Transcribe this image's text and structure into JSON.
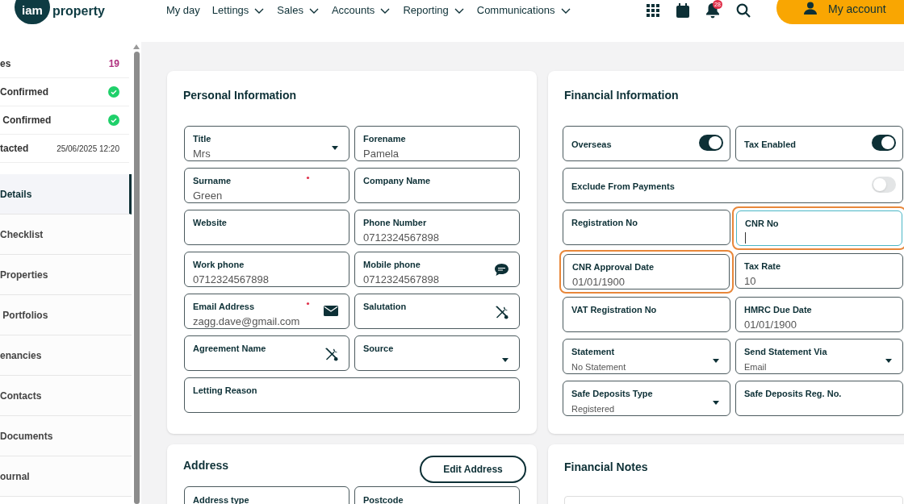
{
  "header": {
    "logo": {
      "badge": "iam",
      "word": "property"
    },
    "nav": [
      {
        "label": "My day",
        "has_menu": false
      },
      {
        "label": "Lettings",
        "has_menu": true
      },
      {
        "label": "Sales",
        "has_menu": true
      },
      {
        "label": "Accounts",
        "has_menu": true
      },
      {
        "label": "Reporting",
        "has_menu": true
      },
      {
        "label": "Communications",
        "has_menu": true
      }
    ],
    "notification_count": "28",
    "account_button": "My account"
  },
  "sidebar": {
    "summary": [
      {
        "label": "es",
        "kind": "count",
        "value": "19"
      },
      {
        "label": "Confirmed",
        "kind": "check",
        "confirmed": true
      },
      {
        "label": " Confirmed",
        "kind": "check",
        "confirmed": true
      },
      {
        "label": "tacted",
        "kind": "text",
        "value": "25/06/2025 12:20"
      }
    ],
    "items": [
      {
        "label": "Details",
        "selected": true
      },
      {
        "label": "Checklist",
        "selected": false
      },
      {
        "label": "Properties",
        "selected": false
      },
      {
        "label": " Portfolios",
        "selected": false
      },
      {
        "label": "enancies",
        "selected": false
      },
      {
        "label": "Contacts",
        "selected": false
      },
      {
        "label": "Documents",
        "selected": false
      },
      {
        "label": "ournal",
        "selected": false
      }
    ]
  },
  "personal": {
    "title": "Personal Information",
    "fields": [
      {
        "kind": "select",
        "label": "Title",
        "value": "Mrs"
      },
      {
        "kind": "text",
        "label": "Forename",
        "value": "Pamela"
      },
      {
        "kind": "text",
        "label": "Surname",
        "value": "Green",
        "required": true
      },
      {
        "kind": "text",
        "label": "Company Name"
      },
      {
        "kind": "text",
        "label": "Website"
      },
      {
        "kind": "text",
        "label": "Phone Number",
        "value": "0712324567898"
      },
      {
        "kind": "text",
        "label": "Work phone",
        "value": "0712324567898"
      },
      {
        "kind": "sms",
        "label": "Mobile phone",
        "value": "0712324567898"
      },
      {
        "kind": "email",
        "label": "Email Address",
        "value": "zagg.dave@gmail.com",
        "required": true
      },
      {
        "kind": "tools",
        "label": "Salutation"
      },
      {
        "kind": "tools",
        "label": "Agreement Name"
      },
      {
        "kind": "select",
        "label": "Source"
      },
      {
        "kind": "text",
        "label": "Letting Reason",
        "wide": true
      }
    ]
  },
  "address": {
    "title": "Address",
    "edit_button": "Edit Address",
    "fields": [
      {
        "label": "Address type"
      },
      {
        "label": "Postcode"
      }
    ]
  },
  "financial": {
    "title": "Financial Information",
    "fields": [
      {
        "kind": "toggle",
        "label": "Overseas",
        "on": true
      },
      {
        "kind": "toggle",
        "label": "Tax Enabled",
        "on": true
      },
      {
        "kind": "toggle",
        "label": "Exclude From Payments",
        "on": false,
        "wide": true
      },
      {
        "kind": "text",
        "label": "Registration No"
      },
      {
        "kind": "text",
        "label": "CNR No",
        "focused": true,
        "highlighted": true
      },
      {
        "kind": "text",
        "label": "CNR Approval Date",
        "value": "01/01/1900",
        "highlighted": true
      },
      {
        "kind": "text",
        "label": "Tax Rate",
        "value": "10"
      },
      {
        "kind": "text",
        "label": "VAT Registration No"
      },
      {
        "kind": "text",
        "label": "HMRC Due Date",
        "value": "01/01/1900"
      },
      {
        "kind": "select",
        "label": "Statement",
        "value": "No Statement",
        "small": true
      },
      {
        "kind": "select",
        "label": "Send Statement Via",
        "value": "Email",
        "small": true
      },
      {
        "kind": "select",
        "label": "Safe Deposits Type",
        "value": "Registered",
        "small": true
      },
      {
        "kind": "text",
        "label": "Safe Deposits Reg. No."
      }
    ]
  },
  "financial_notes": {
    "title": "Financial Notes"
  }
}
